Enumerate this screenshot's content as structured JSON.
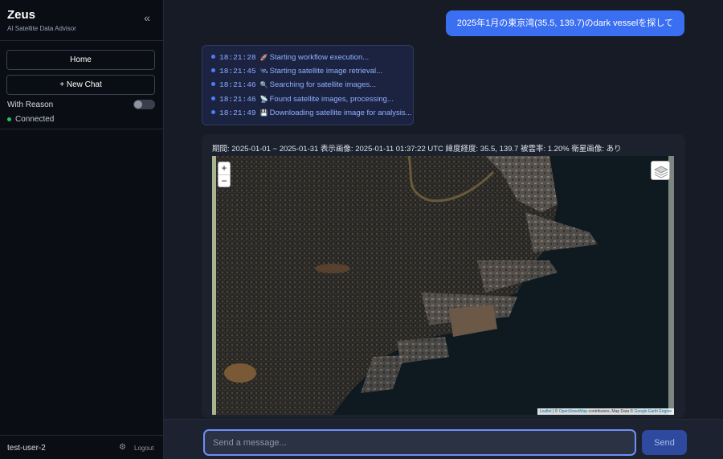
{
  "app": {
    "title": "Zeus",
    "subtitle": "AI Satellite Data Advisor",
    "collapse_icon": "double-chevron-left-icon"
  },
  "sidebar": {
    "home_label": "Home",
    "new_chat_label": "+ New Chat",
    "reason_label": "With Reason",
    "reason_enabled": false,
    "status_label": "Connected",
    "status_color": "#22c55e",
    "user": "test-user-2",
    "logout_label": "Logout",
    "settings_icon": "gear-icon"
  },
  "chat": {
    "user_message": "2025年1月の東京湾(35.5, 139.7)のdark vesselを探して",
    "log": [
      {
        "time": "18:21:28",
        "icon": "rocket-icon",
        "glyph": "🚀",
        "text": "Starting workflow execution..."
      },
      {
        "time": "18:21:45",
        "icon": "satellite-icon",
        "glyph": "🛰",
        "text": "Starting satellite image retrieval..."
      },
      {
        "time": "18:21:46",
        "icon": "magnifier-icon",
        "glyph": "🔍",
        "text": "Searching for satellite images..."
      },
      {
        "time": "18:21:46",
        "icon": "satellite-dish-icon",
        "glyph": "📡",
        "text": "Found satellite images, processing..."
      },
      {
        "time": "18:21:49",
        "icon": "floppy-disk-icon",
        "glyph": "💾",
        "text": "Downloading satellite image for analysis..."
      }
    ],
    "result_meta": "期間: 2025-01-01 ~ 2025-01-31 表示画像: 2025-01-11 01:37:22 UTC 緯度経度: 35.5, 139.7 被雲率: 1.20% 衛星画像: あり"
  },
  "map": {
    "zoom_in": "+",
    "zoom_out": "−",
    "layers_icon": "layers-icon",
    "attribution": {
      "leaflet": "Leaflet",
      "sep1": " | © ",
      "osm": "OpenStreetMap",
      "middle": " contributors, Map Data © ",
      "gee": "Google Earth Engine"
    }
  },
  "composer": {
    "placeholder": "Send a message...",
    "send_label": "Send"
  },
  "colors": {
    "accent": "#3b6ff2",
    "sidebar_bg": "#0a0d14",
    "main_bg": "#161b26",
    "log_bg": "#1b2340"
  }
}
